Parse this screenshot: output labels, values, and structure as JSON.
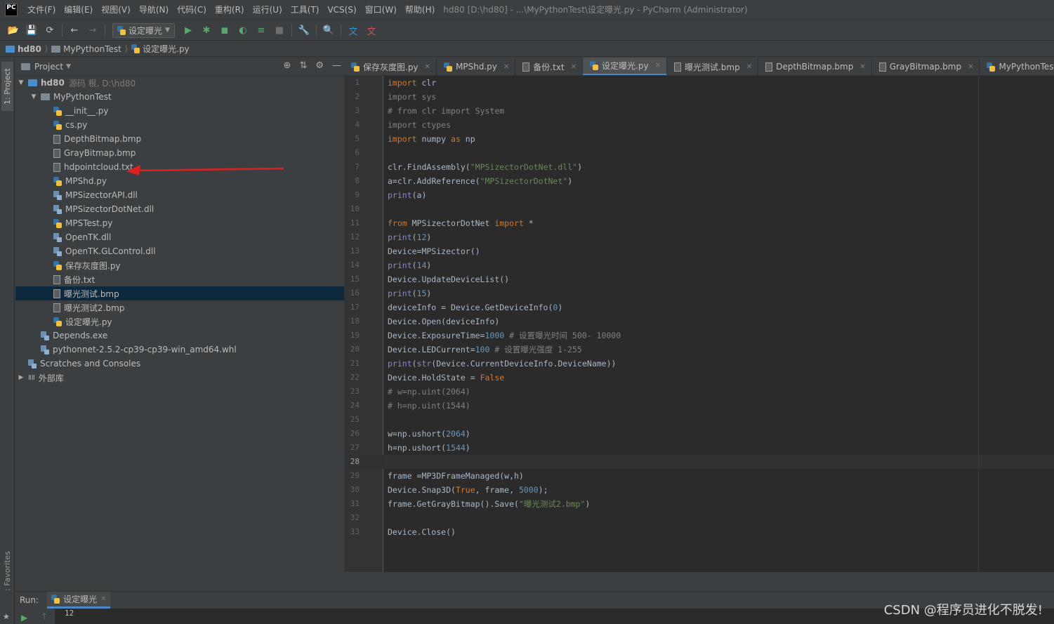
{
  "menubar": {
    "app_logo": "PC",
    "items": [
      "文件(F)",
      "编辑(E)",
      "视图(V)",
      "导航(N)",
      "代码(C)",
      "重构(R)",
      "运行(U)",
      "工具(T)",
      "VCS(S)",
      "窗口(W)",
      "帮助(H)"
    ],
    "window_title": "hd80 [D:\\hd80] - ...\\MyPythonTest\\设定曝光.py - PyCharm (Administrator)"
  },
  "toolbar": {
    "run_config": "设定曝光"
  },
  "breadcrumb": [
    "hd80",
    "MyPythonTest",
    "设定曝光.py"
  ],
  "left_stripe": {
    "project_tab": "1: Project",
    "favorites_tab": "2: Favorites"
  },
  "project": {
    "title": "Project",
    "tree": [
      {
        "label": "hd80",
        "hint": "源码 根, D:\\hd80",
        "level": 0,
        "type": "folder-root",
        "expanded": true
      },
      {
        "label": "MyPythonTest",
        "level": 1,
        "type": "folder",
        "expanded": true
      },
      {
        "label": "__init__.py",
        "level": 2,
        "type": "py"
      },
      {
        "label": "cs.py",
        "level": 2,
        "type": "py"
      },
      {
        "label": "DepthBitmap.bmp",
        "level": 2,
        "type": "file"
      },
      {
        "label": "GrayBitmap.bmp",
        "level": 2,
        "type": "file"
      },
      {
        "label": "hdpointcloud.txt",
        "level": 2,
        "type": "file"
      },
      {
        "label": "MPShd.py",
        "level": 2,
        "type": "py"
      },
      {
        "label": "MPSizectorAPI.dll",
        "level": 2,
        "type": "dll"
      },
      {
        "label": "MPSizectorDotNet.dll",
        "level": 2,
        "type": "dll"
      },
      {
        "label": "MPSTest.py",
        "level": 2,
        "type": "py"
      },
      {
        "label": "OpenTK.dll",
        "level": 2,
        "type": "dll"
      },
      {
        "label": "OpenTK.GLControl.dll",
        "level": 2,
        "type": "dll"
      },
      {
        "label": "保存灰度图.py",
        "level": 2,
        "type": "py"
      },
      {
        "label": "备份.txt",
        "level": 2,
        "type": "file"
      },
      {
        "label": "曝光测试.bmp",
        "level": 2,
        "type": "file",
        "selected": true
      },
      {
        "label": "曝光测试2.bmp",
        "level": 2,
        "type": "file"
      },
      {
        "label": "设定曝光.py",
        "level": 2,
        "type": "py"
      },
      {
        "label": "Depends.exe",
        "level": 1,
        "type": "dll"
      },
      {
        "label": "pythonnet-2.5.2-cp39-cp39-win_amd64.whl",
        "level": 1,
        "type": "dll"
      },
      {
        "label": "Scratches and Consoles",
        "level": 0,
        "type": "scratch"
      },
      {
        "label": "外部库",
        "level": 0,
        "type": "lib",
        "collapsed": true
      }
    ]
  },
  "editor": {
    "tabs": [
      {
        "label": "保存灰度图.py",
        "type": "py",
        "closable": true
      },
      {
        "label": "MPShd.py",
        "type": "py",
        "closable": true
      },
      {
        "label": "备份.txt",
        "type": "file",
        "closable": true
      },
      {
        "label": "设定曝光.py",
        "type": "py",
        "closable": true,
        "active": true
      },
      {
        "label": "曝光测试.bmp",
        "type": "file",
        "closable": true
      },
      {
        "label": "DepthBitmap.bmp",
        "type": "file",
        "closable": true
      },
      {
        "label": "GrayBitmap.bmp",
        "type": "file",
        "closable": true
      },
      {
        "label": "MyPythonTest\\_ini",
        "type": "py",
        "closable": false
      }
    ],
    "current_line": 28,
    "lines": [
      [
        [
          "kw",
          "import"
        ],
        [
          "p",
          " clr"
        ]
      ],
      [
        [
          "cm",
          "import sys"
        ]
      ],
      [
        [
          "cm",
          "# from clr import System"
        ]
      ],
      [
        [
          "cm",
          "import ctypes"
        ]
      ],
      [
        [
          "kw",
          "import"
        ],
        [
          "p",
          " numpy "
        ],
        [
          "kw",
          "as"
        ],
        [
          "p",
          " np"
        ]
      ],
      [],
      [
        [
          "p",
          "clr."
        ],
        [
          "fn",
          "FindAssembly"
        ],
        [
          "p",
          "("
        ],
        [
          "str",
          "\"MPSizectorDotNet.dll\""
        ],
        [
          "p",
          ")"
        ]
      ],
      [
        [
          "p",
          "a=clr."
        ],
        [
          "fn",
          "AddReference"
        ],
        [
          "p",
          "("
        ],
        [
          "str",
          "\"MPSizectorDotNet\""
        ],
        [
          "p",
          ")"
        ]
      ],
      [
        [
          "bi",
          "print"
        ],
        [
          "p",
          "(a)"
        ]
      ],
      [],
      [
        [
          "kw",
          "from"
        ],
        [
          "p",
          " MPSizectorDotNet "
        ],
        [
          "kw",
          "import"
        ],
        [
          "p",
          " *"
        ]
      ],
      [
        [
          "bi",
          "print"
        ],
        [
          "p",
          "("
        ],
        [
          "num",
          "12"
        ],
        [
          "p",
          ")"
        ]
      ],
      [
        [
          "p",
          "Device=MPSizector()"
        ]
      ],
      [
        [
          "bi",
          "print"
        ],
        [
          "p",
          "("
        ],
        [
          "num",
          "14"
        ],
        [
          "p",
          ")"
        ]
      ],
      [
        [
          "p",
          "Device.UpdateDeviceList()"
        ]
      ],
      [
        [
          "bi",
          "print"
        ],
        [
          "p",
          "("
        ],
        [
          "num",
          "15"
        ],
        [
          "p",
          ")"
        ]
      ],
      [
        [
          "p",
          "deviceInfo = Device.GetDeviceInfo("
        ],
        [
          "num",
          "0"
        ],
        [
          "p",
          ")"
        ]
      ],
      [
        [
          "p",
          "Device.Open(deviceInfo)"
        ]
      ],
      [
        [
          "p",
          "Device.ExposureTime="
        ],
        [
          "num",
          "1000"
        ],
        [
          "p",
          " "
        ],
        [
          "cm",
          "# 设置曝光时间 500- 10000"
        ]
      ],
      [
        [
          "p",
          "Device.LEDCurrent="
        ],
        [
          "num",
          "100"
        ],
        [
          "p",
          " "
        ],
        [
          "cm",
          "# 设置曝光强度 1-255"
        ]
      ],
      [
        [
          "bi",
          "print"
        ],
        [
          "p",
          "("
        ],
        [
          "bi",
          "str"
        ],
        [
          "p",
          "(Device.CurrentDeviceInfo.DeviceName))"
        ]
      ],
      [
        [
          "p",
          "Device.HoldState = "
        ],
        [
          "kw",
          "False"
        ]
      ],
      [
        [
          "cm",
          "# w=np.uint(2064)"
        ]
      ],
      [
        [
          "cm",
          "# h=np.uint(1544)"
        ]
      ],
      [],
      [
        [
          "p",
          "w=np.ushort("
        ],
        [
          "num",
          "2064"
        ],
        [
          "p",
          ")"
        ]
      ],
      [
        [
          "p",
          "h=np.ushort("
        ],
        [
          "num",
          "1544"
        ],
        [
          "p",
          ")"
        ]
      ],
      [],
      [
        [
          "p",
          "frame =MP3DFrameManaged(w,h)"
        ]
      ],
      [
        [
          "p",
          "Device.Snap3D("
        ],
        [
          "kw",
          "True"
        ],
        [
          "p",
          ", frame, "
        ],
        [
          "num",
          "5000"
        ],
        [
          "p",
          ");"
        ]
      ],
      [
        [
          "p",
          "frame.GetGrayBitmap().Save("
        ],
        [
          "str",
          "\"曝光测试2.bmp\""
        ],
        [
          "p",
          ")"
        ]
      ],
      [],
      [
        [
          "p",
          "Device.Close()"
        ]
      ]
    ],
    "colors": {
      "kw": "#cc7832",
      "cm": "#808080",
      "str": "#6a8759",
      "num": "#6897bb",
      "bi": "#8888c6",
      "fn": "#a9b7c6",
      "p": "#a9b7c6"
    }
  },
  "run": {
    "label": "Run:",
    "tab": "设定曝光",
    "output": "12"
  },
  "watermark": "CSDN @程序员进化不脱发!"
}
